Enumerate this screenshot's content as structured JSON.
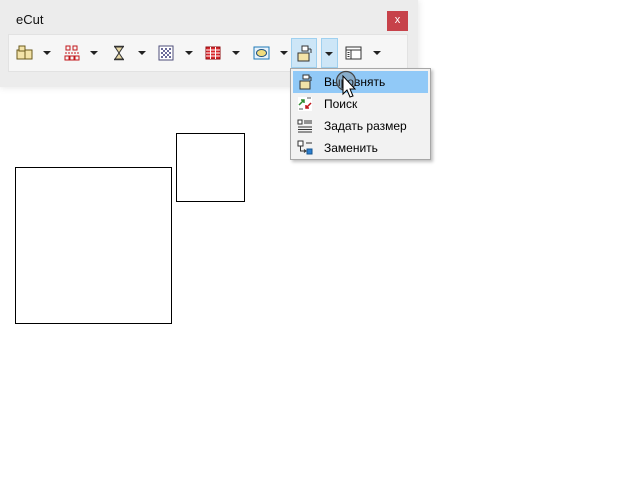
{
  "window": {
    "title": "eCut",
    "close_label": "x"
  },
  "toolbar": {
    "buttons": [
      {
        "name": "layout-icon"
      },
      {
        "name": "array-icon"
      },
      {
        "name": "hourglass-icon"
      },
      {
        "name": "pattern-icon"
      },
      {
        "name": "grid-table-icon"
      },
      {
        "name": "ellipse-icon"
      },
      {
        "name": "align-icon"
      },
      {
        "name": "panel-icon"
      }
    ],
    "active_button": "align-icon"
  },
  "menu": {
    "items": [
      {
        "label": "Выровнять",
        "icon": "align-icon",
        "highlighted": true
      },
      {
        "label": "Поиск",
        "icon": "search-arrows-icon",
        "highlighted": false
      },
      {
        "label": "Задать размер",
        "icon": "set-size-icon",
        "highlighted": false
      },
      {
        "label": "Заменить",
        "icon": "replace-icon",
        "highlighted": false
      }
    ]
  },
  "colors": {
    "menu_highlight": "#91c9f7",
    "close_button": "#c7424a",
    "active_button": "#cde6f7"
  }
}
